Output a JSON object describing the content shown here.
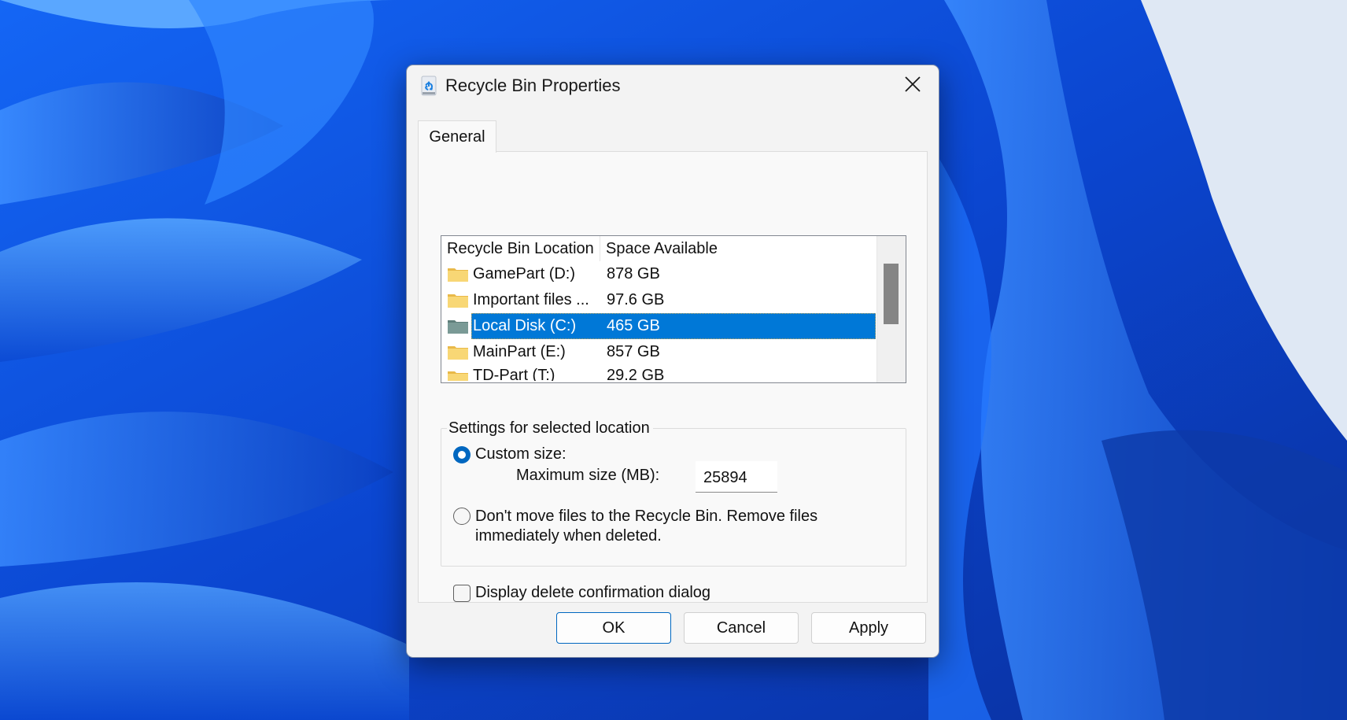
{
  "dialog": {
    "title": "Recycle Bin Properties",
    "title_icon": "recycle-bin-icon",
    "close_icon": "close-icon"
  },
  "tabs": [
    {
      "label": "General",
      "active": true
    }
  ],
  "locations": {
    "columns": [
      "Recycle Bin Location",
      "Space Available"
    ],
    "rows": [
      {
        "name": "GamePart (D:)",
        "space": "878 GB",
        "icon": "folder-icon",
        "selected": false
      },
      {
        "name": "Important files ...",
        "space": "97.6 GB",
        "icon": "folder-icon",
        "selected": false
      },
      {
        "name": "Local Disk (C:)",
        "space": "465 GB",
        "icon": "folder-icon",
        "selected": true
      },
      {
        "name": "MainPart (E:)",
        "space": "857 GB",
        "icon": "folder-icon",
        "selected": false
      },
      {
        "name": "TD-Part (T:)",
        "space": "29.2 GB",
        "icon": "folder-icon",
        "selected": false
      }
    ]
  },
  "settings": {
    "group_label": "Settings for selected location",
    "custom_size_label": "Custom size:",
    "custom_size_selected": true,
    "max_size_label": "Maximum size (MB):",
    "max_size_value": "25894",
    "dont_move_label": "Don't move files to the Recycle Bin. Remove files immediately when deleted.",
    "dont_move_selected": false,
    "confirm_label": "Display delete confirmation dialog",
    "confirm_checked": false
  },
  "buttons": {
    "ok": "OK",
    "cancel": "Cancel",
    "apply": "Apply"
  },
  "colors": {
    "accent": "#0067c0",
    "selection": "#0078d7",
    "folder_yellow": "#f8d775",
    "folder_selected": "#7a9a96"
  }
}
